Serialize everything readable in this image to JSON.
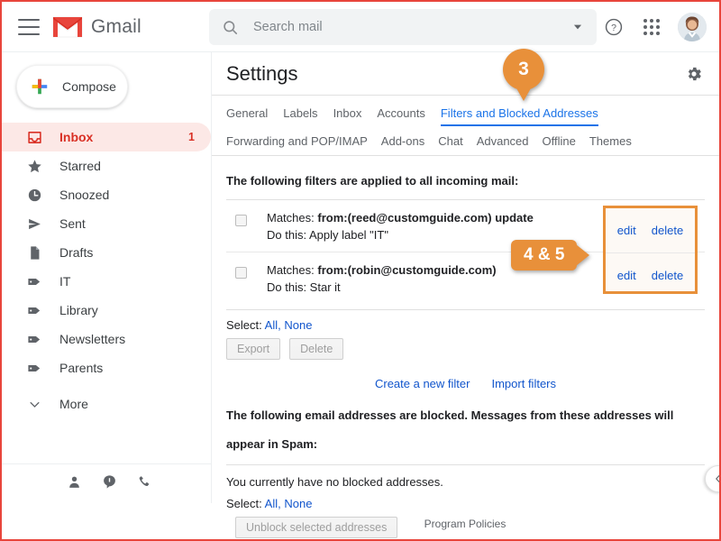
{
  "window": {
    "accent_red": "#e8453c",
    "callout_orange": "#e8903a",
    "link_blue": "#1155cc"
  },
  "topbar": {
    "menu_icon": "hamburger-icon",
    "brand": "Gmail",
    "search": {
      "placeholder": "Search mail",
      "value": "",
      "icon": "search-icon",
      "caret_icon": "chevron-down-icon"
    },
    "help_icon": "help-circle-icon",
    "apps_icon": "apps-grid-icon",
    "avatar": "user-avatar"
  },
  "sidebar": {
    "compose": {
      "label": "Compose",
      "icon": "plus-icon"
    },
    "items": [
      {
        "label": "Inbox",
        "icon": "inbox-icon",
        "count": "1",
        "active": true
      },
      {
        "label": "Starred",
        "icon": "star-icon",
        "count": "",
        "active": false
      },
      {
        "label": "Snoozed",
        "icon": "clock-icon",
        "count": "",
        "active": false
      },
      {
        "label": "Sent",
        "icon": "send-icon",
        "count": "",
        "active": false
      },
      {
        "label": "Drafts",
        "icon": "document-icon",
        "count": "",
        "active": false
      },
      {
        "label": "IT",
        "icon": "label-tag-icon",
        "count": "",
        "active": false
      },
      {
        "label": "Library",
        "icon": "label-tag-icon",
        "count": "",
        "active": false
      },
      {
        "label": "Newsletters",
        "icon": "label-tag-icon",
        "count": "",
        "active": false
      },
      {
        "label": "Parents",
        "icon": "label-tag-icon",
        "count": "",
        "active": false
      },
      {
        "label": "More",
        "icon": "chevron-down-icon",
        "count": "",
        "active": false
      }
    ],
    "bottom_icons": [
      "person-icon",
      "chat-bubble-icon",
      "phone-icon"
    ]
  },
  "settings": {
    "title": "Settings",
    "gear_icon": "gear-icon",
    "tabs_row1": [
      "General",
      "Labels",
      "Inbox",
      "Accounts",
      "Filters and Blocked Addresses"
    ],
    "tabs_row2": [
      "Forwarding and POP/IMAP",
      "Add-ons",
      "Chat",
      "Advanced",
      "Offline",
      "Themes"
    ],
    "selected_tab": "Filters and Blocked Addresses"
  },
  "filters": {
    "heading": "The following filters are applied to all incoming mail:",
    "rows": [
      {
        "matches_prefix": "Matches: ",
        "matches_bold": "from:(reed@customguide.com) update",
        "action": "Do this: Apply label \"IT\"",
        "edit": "edit",
        "delete": "delete"
      },
      {
        "matches_prefix": "Matches: ",
        "matches_bold": "from:(robin@customguide.com)",
        "action": "Do this: Star it",
        "edit": "edit",
        "delete": "delete"
      }
    ],
    "select_label": "Select:",
    "select_all": "All,",
    "select_none": "None",
    "export_btn": "Export",
    "delete_btn": "Delete",
    "create_filter_link": "Create a new filter",
    "import_filters_link": "Import filters"
  },
  "blocked": {
    "heading_line1": "The following email addresses are blocked. Messages from these addresses will",
    "heading_line2": "appear in Spam:",
    "empty_text": "You currently have no blocked addresses.",
    "select_label": "Select:",
    "select_all": "All,",
    "select_none": "None",
    "unblock_btn": "Unblock selected addresses"
  },
  "footer": {
    "program_policies": "Program Policies",
    "collapse_icon": "chevron-left-icon"
  },
  "callouts": [
    {
      "id": "pin-3",
      "text": "3",
      "shape": "pin"
    },
    {
      "id": "tag-4-5",
      "text": "4 & 5",
      "shape": "tag"
    }
  ]
}
